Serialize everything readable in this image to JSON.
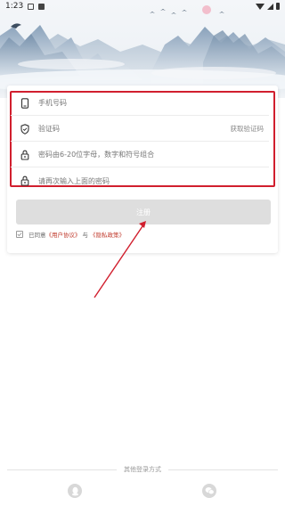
{
  "status_bar": {
    "time": "1:23",
    "icons": [
      "image-icon",
      "notification-icon",
      "wifi-icon",
      "signal-icon",
      "battery-icon"
    ]
  },
  "header": {
    "art": "ink-landscape-mountains"
  },
  "form": {
    "phone": {
      "placeholder": "手机号码",
      "icon": "phone-icon"
    },
    "code": {
      "placeholder": "验证码",
      "icon": "shield-icon",
      "get_code_label": "获取验证码"
    },
    "password": {
      "placeholder": "密码由6-20位字母，数字和符号组合",
      "icon": "lock-icon"
    },
    "confirm_password": {
      "placeholder": "请再次输入上面的密码",
      "icon": "lock-icon"
    },
    "register_label": "注册",
    "agreement": {
      "prefix": "已同意",
      "user_agreement": "《用户协议》",
      "connector": "与",
      "privacy_policy": "《隐私政策》"
    }
  },
  "other_login": {
    "label": "其他登录方式",
    "providers": [
      "qq-icon",
      "wechat-icon"
    ]
  },
  "colors": {
    "highlight": "#d11f2e",
    "link": "#c0392b",
    "button_disabled": "#dedede"
  }
}
